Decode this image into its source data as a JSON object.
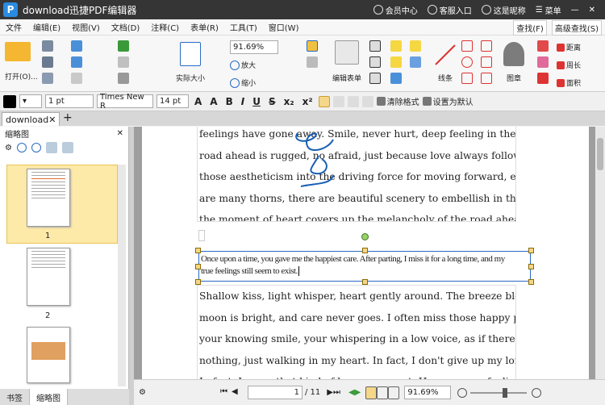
{
  "window": {
    "title": "download迅捷PDF编辑器",
    "logo_letter": "P",
    "member": "会员中心",
    "support": "客服入口",
    "user": "这是昵称",
    "menu": "菜单"
  },
  "menu": {
    "items": [
      "文件",
      "编辑(E)",
      "视图(V)",
      "文档(D)",
      "注释(C)",
      "表单(R)",
      "工具(T)",
      "窗口(W)"
    ],
    "find": "查找(F)",
    "adv_find": "高级查找(S)"
  },
  "ribbon": {
    "open": "打开(O)...",
    "actual_size": "实际大小",
    "zoom": "91.69%",
    "zoom_in": "放大",
    "zoom_out": "缩小",
    "edit_form": "编辑表单",
    "line": "线条",
    "stamp": "图章",
    "distance": "距离",
    "perimeter": "周长",
    "area": "面积"
  },
  "format": {
    "line_width": "1 pt",
    "font": "Times New R",
    "size": "14 pt",
    "clear": "清除格式",
    "default": "设置为默认"
  },
  "tab": {
    "name": "download"
  },
  "left_panel": {
    "title": "缩略图",
    "page1": "1",
    "page2": "2",
    "bookmarks": "书签",
    "thumbs": "缩略图"
  },
  "doc": {
    "top_lines": [
      "feelings have gone away. Smile, never hurt, deep feeling in the heart. The",
      "road ahead is rugged, no afraid, just because love always follows. Turn",
      "those aestheticism into the driving force for moving forward, even if there",
      "are many thorns, there are beautiful scenery to embellish in the past, and",
      "the moment of heart covers up the melancholy of the road ahead."
    ],
    "edit_lines": [
      "Once upon a time, you gave me the happiest care. After parting, I miss it for a long time, and my",
      "true feelings still seem to exist."
    ],
    "bottom_lines": [
      "Shallow kiss, light whisper, heart gently around. The breeze blows, the",
      "moon is bright, and care never goes. I often miss those happy past events,",
      "your knowing smile, your whispering in a low voice, as if there were",
      "nothing, just walking in my heart. In fact, I don't give up my long journey.",
      "In fact, I crave that kind of happy moment. However, my feelings are like"
    ]
  },
  "status": {
    "page": "1",
    "page_total": "/ 11",
    "zoom": "91.69%"
  }
}
